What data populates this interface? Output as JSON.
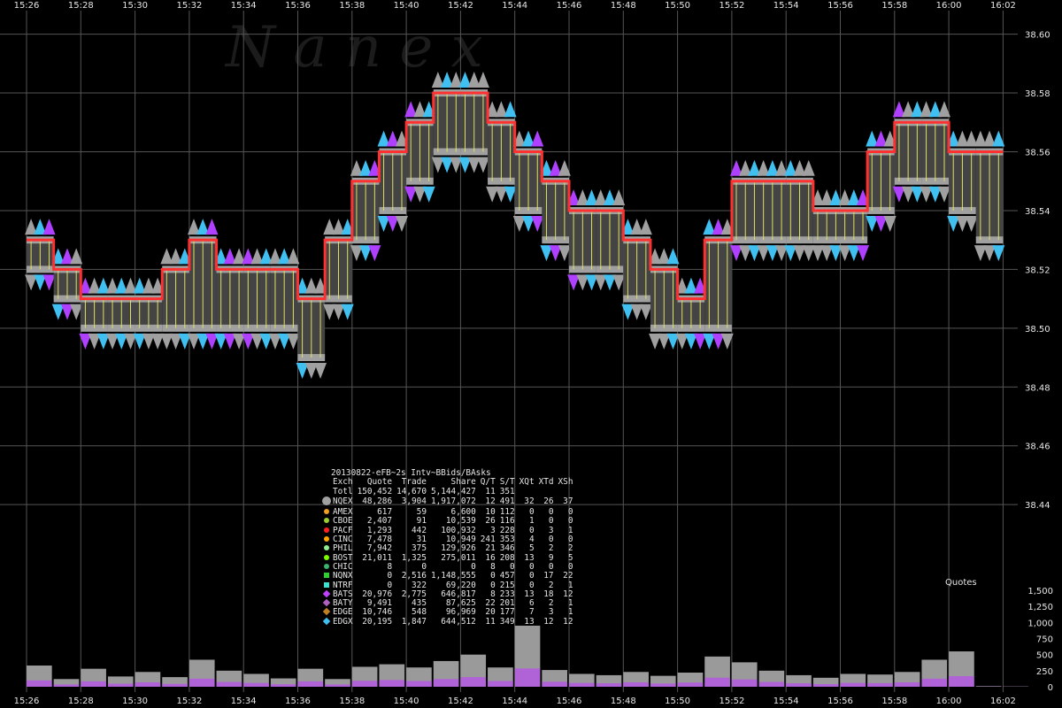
{
  "watermark": "N a n e x",
  "stats_title": "20130822-eFB~2s Intv~BBids/BAsks",
  "stats_headers": [
    "Exch",
    "Quote",
    "Trade",
    "Share",
    "Q/T",
    "S/T",
    "XQt",
    "XTd",
    "XSh"
  ],
  "stats_rows": [
    {
      "exch": "Totl",
      "quote": "150,452",
      "trade": "14,670",
      "share": "5,144,427",
      "qt": "11",
      "st": "351",
      "xqt": "",
      "xtd": "",
      "xsh": "",
      "marker": "none",
      "color": ""
    },
    {
      "exch": "NQEX",
      "quote": "48,286",
      "trade": "3,904",
      "share": "1,917,072",
      "qt": "12",
      "st": "491",
      "xqt": "32",
      "xtd": "26",
      "xsh": "37",
      "marker": "big-circle",
      "color": "#a0a0a0"
    },
    {
      "exch": "AMEX",
      "quote": "617",
      "trade": "59",
      "share": "6,600",
      "qt": "10",
      "st": "112",
      "xqt": "0",
      "xtd": "0",
      "xsh": "0",
      "marker": "dot",
      "color": "#f0a020"
    },
    {
      "exch": "CBOE",
      "quote": "2,407",
      "trade": "91",
      "share": "10,539",
      "qt": "26",
      "st": "116",
      "xqt": "1",
      "xtd": "0",
      "xsh": "0",
      "marker": "dot",
      "color": "#9acd32"
    },
    {
      "exch": "PACF",
      "quote": "1,293",
      "trade": "442",
      "share": "100,932",
      "qt": "3",
      "st": "228",
      "xqt": "0",
      "xtd": "3",
      "xsh": "1",
      "marker": "dot",
      "color": "#ff2020"
    },
    {
      "exch": "CINC",
      "quote": "7,478",
      "trade": "31",
      "share": "10,949",
      "qt": "241",
      "st": "353",
      "xqt": "4",
      "xtd": "0",
      "xsh": "0",
      "marker": "dot",
      "color": "#ffa500"
    },
    {
      "exch": "PHIL",
      "quote": "7,942",
      "trade": "375",
      "share": "129,926",
      "qt": "21",
      "st": "346",
      "xqt": "5",
      "xtd": "2",
      "xsh": "2",
      "marker": "dot",
      "color": "#90ee90"
    },
    {
      "exch": "BOST",
      "quote": "21,011",
      "trade": "1,325",
      "share": "275,011",
      "qt": "16",
      "st": "208",
      "xqt": "13",
      "xtd": "9",
      "xsh": "5",
      "marker": "dot",
      "color": "#7cfc00"
    },
    {
      "exch": "CHIC",
      "quote": "8",
      "trade": "0",
      "share": "0",
      "qt": "8",
      "st": "0",
      "xqt": "0",
      "xtd": "0",
      "xsh": "0",
      "marker": "dot",
      "color": "#3cb371"
    },
    {
      "exch": "NQNX",
      "quote": "0",
      "trade": "2,516",
      "share": "1,148,555",
      "qt": "0",
      "st": "457",
      "xqt": "0",
      "xtd": "17",
      "xsh": "22",
      "marker": "square",
      "color": "#32cd32"
    },
    {
      "exch": "NTRF",
      "quote": "0",
      "trade": "322",
      "share": "69,220",
      "qt": "0",
      "st": "215",
      "xqt": "0",
      "xtd": "2",
      "xsh": "1",
      "marker": "square",
      "color": "#40e0d0"
    },
    {
      "exch": "BATS",
      "quote": "20,976",
      "trade": "2,775",
      "share": "646,817",
      "qt": "8",
      "st": "233",
      "xqt": "13",
      "xtd": "18",
      "xsh": "12",
      "marker": "diamond",
      "color": "#c040ff"
    },
    {
      "exch": "BATY",
      "quote": "9,491",
      "trade": "435",
      "share": "87,625",
      "qt": "22",
      "st": "201",
      "xqt": "6",
      "xtd": "2",
      "xsh": "1",
      "marker": "diamond",
      "color": "#b060c0"
    },
    {
      "exch": "EDGE",
      "quote": "10,746",
      "trade": "548",
      "share": "96,969",
      "qt": "20",
      "st": "177",
      "xqt": "7",
      "xtd": "3",
      "xsh": "1",
      "marker": "diamond",
      "color": "#c08020"
    },
    {
      "exch": "EDGX",
      "quote": "20,195",
      "trade": "1,847",
      "share": "644,512",
      "qt": "11",
      "st": "349",
      "xqt": "13",
      "xtd": "12",
      "xsh": "12",
      "marker": "diamond",
      "color": "#40c0f0"
    }
  ],
  "chart_data": [
    {
      "type": "line",
      "x_tick_labels": [
        "15:26",
        "15:28",
        "15:30",
        "15:32",
        "15:34",
        "15:36",
        "15:38",
        "15:40",
        "15:42",
        "15:44",
        "15:46",
        "15:48",
        "15:50",
        "15:52",
        "15:54",
        "15:56",
        "15:58",
        "16:00",
        "16:02"
      ],
      "y_tick_labels": [
        "38.60",
        "38.58",
        "38.56",
        "38.54",
        "38.52",
        "38.50",
        "38.48",
        "38.46",
        "38.44"
      ],
      "ylim": [
        38.425,
        38.605
      ],
      "grid": true,
      "series": [
        {
          "name": "BBid",
          "color": "#000000",
          "x": [
            "15:26",
            "15:27",
            "15:28",
            "15:29",
            "15:30",
            "15:31",
            "15:32",
            "15:33",
            "15:34",
            "15:35",
            "15:36",
            "15:37",
            "15:38",
            "15:39",
            "15:40",
            "15:41",
            "15:42",
            "15:43",
            "15:44",
            "15:45",
            "15:46",
            "15:47",
            "15:48",
            "15:49",
            "15:50",
            "15:51",
            "15:52",
            "15:53",
            "15:54",
            "15:55",
            "15:56",
            "15:57",
            "15:58",
            "15:59",
            "16:00",
            "16:01",
            "16:02"
          ],
          "y": [
            38.52,
            38.51,
            38.5,
            38.5,
            38.5,
            38.5,
            38.5,
            38.5,
            38.5,
            38.5,
            38.49,
            38.51,
            38.53,
            38.54,
            38.55,
            38.56,
            38.56,
            38.55,
            38.54,
            38.53,
            38.52,
            38.52,
            38.51,
            38.5,
            38.5,
            38.5,
            38.53,
            38.53,
            38.53,
            38.53,
            38.53,
            38.54,
            38.55,
            38.55,
            38.54,
            38.53,
            38.54
          ]
        },
        {
          "name": "BAsk",
          "color": "#ff3030",
          "x": [
            "15:26",
            "15:27",
            "15:28",
            "15:29",
            "15:30",
            "15:31",
            "15:32",
            "15:33",
            "15:34",
            "15:35",
            "15:36",
            "15:37",
            "15:38",
            "15:39",
            "15:40",
            "15:41",
            "15:42",
            "15:43",
            "15:44",
            "15:45",
            "15:46",
            "15:47",
            "15:48",
            "15:49",
            "15:50",
            "15:51",
            "15:52",
            "15:53",
            "15:54",
            "15:55",
            "15:56",
            "15:57",
            "15:58",
            "15:59",
            "16:00",
            "16:01",
            "16:02"
          ],
          "y": [
            38.53,
            38.52,
            38.51,
            38.51,
            38.51,
            38.52,
            38.53,
            38.52,
            38.52,
            38.52,
            38.51,
            38.53,
            38.55,
            38.56,
            38.57,
            38.58,
            38.58,
            38.57,
            38.56,
            38.55,
            38.54,
            38.54,
            38.53,
            38.52,
            38.51,
            38.53,
            38.55,
            38.55,
            38.55,
            38.54,
            38.54,
            38.56,
            38.57,
            38.57,
            38.56,
            38.56,
            38.56
          ]
        }
      ]
    },
    {
      "type": "bar",
      "title": "Quotes",
      "y_tick_labels": [
        "1,500",
        "1,250",
        "1,000",
        "750",
        "500",
        "250",
        "0"
      ],
      "ylim": [
        0,
        1500
      ],
      "grid": false,
      "x": [
        "15:26",
        "15:27",
        "15:28",
        "15:29",
        "15:30",
        "15:31",
        "15:32",
        "15:33",
        "15:34",
        "15:35",
        "15:36",
        "15:37",
        "15:38",
        "15:39",
        "15:40",
        "15:41",
        "15:42",
        "15:43",
        "15:44",
        "15:45",
        "15:46",
        "15:47",
        "15:48",
        "15:49",
        "15:50",
        "15:51",
        "15:52",
        "15:53",
        "15:54",
        "15:55",
        "15:56",
        "15:57",
        "15:58",
        "15:59",
        "16:00",
        "16:01",
        "16:02"
      ],
      "values": [
        330,
        120,
        280,
        160,
        230,
        150,
        420,
        250,
        200,
        130,
        280,
        120,
        310,
        350,
        300,
        400,
        500,
        300,
        950,
        260,
        200,
        180,
        230,
        170,
        220,
        470,
        380,
        250,
        180,
        140,
        200,
        190,
        230,
        420,
        550,
        10,
        5
      ]
    }
  ]
}
